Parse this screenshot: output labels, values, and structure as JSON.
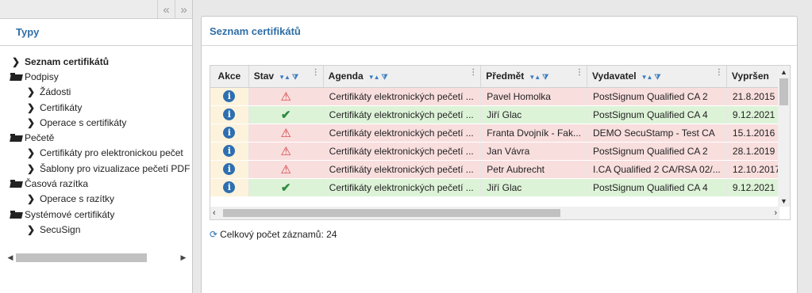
{
  "left_panel": {
    "title": "Typy",
    "collapse_icons": [
      "«",
      "»"
    ],
    "tree": [
      {
        "label": "Seznam certifikátů",
        "level": 0,
        "kind": "item",
        "selected": true
      },
      {
        "label": "Podpisy",
        "level": 0,
        "kind": "folder"
      },
      {
        "label": "Žádosti",
        "level": 1,
        "kind": "item"
      },
      {
        "label": "Certifikáty",
        "level": 1,
        "kind": "item"
      },
      {
        "label": "Operace s certifikáty",
        "level": 1,
        "kind": "item"
      },
      {
        "label": "Pečetě",
        "level": 0,
        "kind": "folder"
      },
      {
        "label": "Certifikáty pro elektronickou pečet",
        "level": 1,
        "kind": "item"
      },
      {
        "label": "Šablony pro vizualizace pečetí PDF",
        "level": 1,
        "kind": "item"
      },
      {
        "label": "Časová razítka",
        "level": 0,
        "kind": "folder"
      },
      {
        "label": "Operace s razítky",
        "level": 1,
        "kind": "item"
      },
      {
        "label": "Systémové certifikáty",
        "level": 0,
        "kind": "folder"
      },
      {
        "label": "SecuSign",
        "level": 1,
        "kind": "item"
      }
    ]
  },
  "right_panel": {
    "title": "Seznam certifikátů",
    "columns": [
      "Akce",
      "Stav",
      "Agenda",
      "Předmět",
      "Vydavatel",
      "Vypršen"
    ],
    "rows": [
      {
        "status": "warning",
        "agenda": "Certifikáty elektronických pečetí ...",
        "subject": "Pavel Homolka",
        "issuer": "PostSignum Qualified CA 2",
        "expires": "21.8.2015"
      },
      {
        "status": "ok",
        "agenda": "Certifikáty elektronických pečetí ...",
        "subject": "Jiří Glac",
        "issuer": "PostSignum Qualified CA 4",
        "expires": "9.12.2021"
      },
      {
        "status": "warning",
        "agenda": "Certifikáty elektronických pečetí ...",
        "subject": "Franta Dvojník - Fak...",
        "issuer": "DEMO SecuStamp - Test CA",
        "expires": "15.1.2016"
      },
      {
        "status": "warning",
        "agenda": "Certifikáty elektronických pečetí ...",
        "subject": "Jan Vávra",
        "issuer": "PostSignum Qualified CA 2",
        "expires": "28.1.2019"
      },
      {
        "status": "warning",
        "agenda": "Certifikáty elektronických pečetí ...",
        "subject": "Petr Aubrecht",
        "issuer": "I.CA Qualified 2 CA/RSA 02/...",
        "expires": "12.10.2017"
      },
      {
        "status": "ok",
        "agenda": "Certifikáty elektronických pečetí ...",
        "subject": "Jiří Glac",
        "issuer": "PostSignum Qualified CA 4",
        "expires": "9.12.2021"
      }
    ],
    "status_text": "Celkový počet záznamů: 24",
    "colors": {
      "warning_row": "#f9dede",
      "ok_row": "#ddf3d8",
      "action_cell": "#fdf3dc",
      "accent": "#2f6ea6"
    }
  }
}
